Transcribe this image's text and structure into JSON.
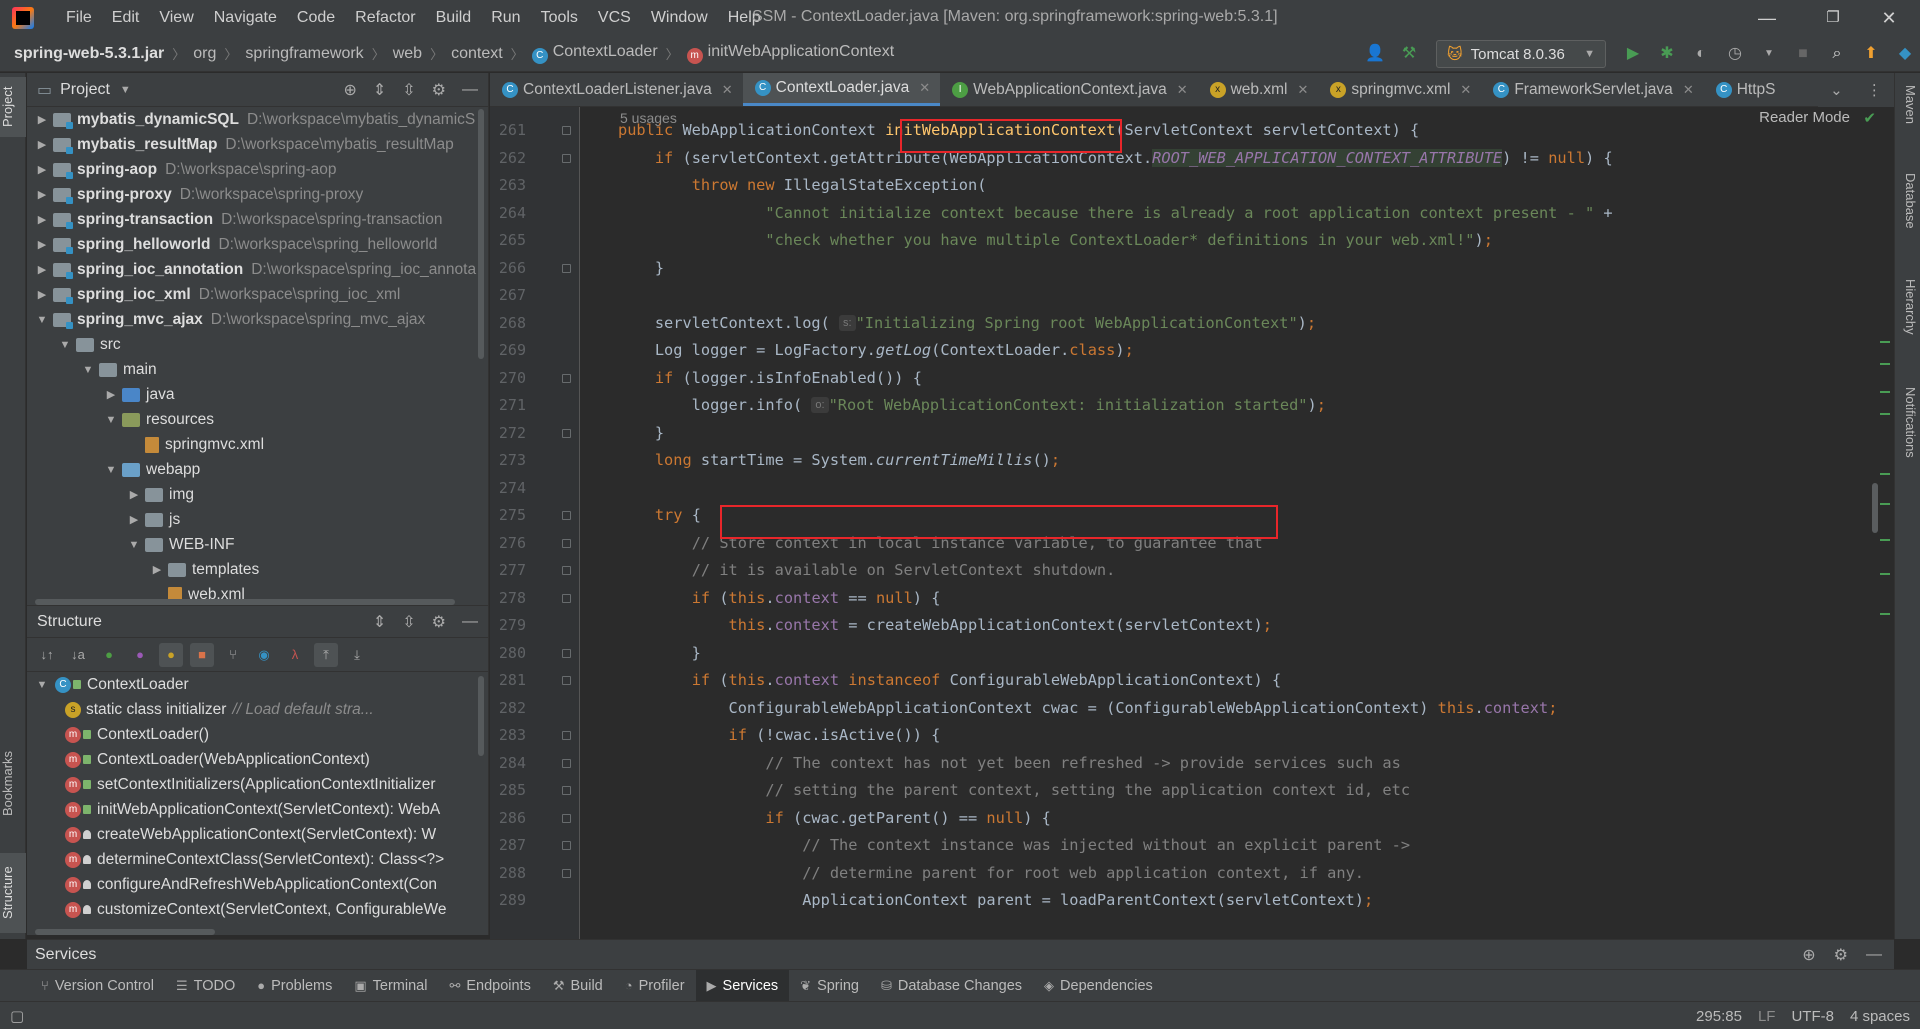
{
  "titlebar": {
    "menu": [
      "File",
      "Edit",
      "View",
      "Navigate",
      "Code",
      "Refactor",
      "Build",
      "Run",
      "Tools",
      "VCS",
      "Window",
      "Help"
    ],
    "window_title": "SSM - ContextLoader.java [Maven: org.springframework:spring-web:5.3.1]",
    "controls": [
      "—",
      "❐",
      "✕"
    ]
  },
  "breadcrumbs": [
    "spring-web-5.3.1.jar",
    "org",
    "springframework",
    "web",
    "context",
    "ContextLoader",
    "initWebApplicationContext"
  ],
  "run_config": "Tomcat 8.0.36",
  "project_panel": {
    "title": "Project",
    "rows": [
      {
        "name": "mybatis_dynamicSQL",
        "path": "D:\\workspace\\mybatis_dynamicS",
        "depth": 0,
        "arrow": "▶",
        "kind": "module"
      },
      {
        "name": "mybatis_resultMap",
        "path": "D:\\workspace\\mybatis_resultMap",
        "depth": 0,
        "arrow": "▶",
        "kind": "module"
      },
      {
        "name": "spring-aop",
        "path": "D:\\workspace\\spring-aop",
        "depth": 0,
        "arrow": "▶",
        "kind": "module"
      },
      {
        "name": "spring-proxy",
        "path": "D:\\workspace\\spring-proxy",
        "depth": 0,
        "arrow": "▶",
        "kind": "module"
      },
      {
        "name": "spring-transaction",
        "path": "D:\\workspace\\spring-transaction",
        "depth": 0,
        "arrow": "▶",
        "kind": "module"
      },
      {
        "name": "spring_helloworld",
        "path": "D:\\workspace\\spring_helloworld",
        "depth": 0,
        "arrow": "▶",
        "kind": "module"
      },
      {
        "name": "spring_ioc_annotation",
        "path": "D:\\workspace\\spring_ioc_annota",
        "depth": 0,
        "arrow": "▶",
        "kind": "module"
      },
      {
        "name": "spring_ioc_xml",
        "path": "D:\\workspace\\spring_ioc_xml",
        "depth": 0,
        "arrow": "▶",
        "kind": "module"
      },
      {
        "name": "spring_mvc_ajax",
        "path": "D:\\workspace\\spring_mvc_ajax",
        "depth": 0,
        "arrow": "▼",
        "kind": "module"
      },
      {
        "name": "src",
        "path": "",
        "depth": 1,
        "arrow": "▼",
        "kind": "folder"
      },
      {
        "name": "main",
        "path": "",
        "depth": 2,
        "arrow": "▼",
        "kind": "folder"
      },
      {
        "name": "java",
        "path": "",
        "depth": 3,
        "arrow": "▶",
        "kind": "src"
      },
      {
        "name": "resources",
        "path": "",
        "depth": 3,
        "arrow": "▼",
        "kind": "res"
      },
      {
        "name": "springmvc.xml",
        "path": "",
        "depth": 4,
        "arrow": "",
        "kind": "file"
      },
      {
        "name": "webapp",
        "path": "",
        "depth": 3,
        "arrow": "▼",
        "kind": "web"
      },
      {
        "name": "img",
        "path": "",
        "depth": 4,
        "arrow": "▶",
        "kind": "folder"
      },
      {
        "name": "js",
        "path": "",
        "depth": 4,
        "arrow": "▶",
        "kind": "folder"
      },
      {
        "name": "WEB-INF",
        "path": "",
        "depth": 4,
        "arrow": "▼",
        "kind": "folder"
      },
      {
        "name": "templates",
        "path": "",
        "depth": 5,
        "arrow": "▶",
        "kind": "folder"
      },
      {
        "name": "web.xml",
        "path": "",
        "depth": 5,
        "arrow": "",
        "kind": "file"
      }
    ]
  },
  "structure_panel": {
    "title": "Structure",
    "rows": [
      {
        "text": "ContextLoader",
        "hint": "",
        "icon": "c",
        "letter": "C",
        "access": "public",
        "depth": 0,
        "arrow": "▼"
      },
      {
        "text": "static class initializer",
        "hint": "// Load default stra...",
        "icon": "f",
        "letter": "s",
        "access": "",
        "depth": 1,
        "arrow": ""
      },
      {
        "text": "ContextLoader()",
        "hint": "",
        "icon": "m",
        "letter": "m",
        "access": "public",
        "depth": 1,
        "arrow": ""
      },
      {
        "text": "ContextLoader(WebApplicationContext)",
        "hint": "",
        "icon": "m",
        "letter": "m",
        "access": "public",
        "depth": 1,
        "arrow": ""
      },
      {
        "text": "setContextInitializers(ApplicationContextInitializer",
        "hint": "",
        "icon": "m",
        "letter": "m",
        "access": "public",
        "depth": 1,
        "arrow": ""
      },
      {
        "text": "initWebApplicationContext(ServletContext): WebA",
        "hint": "",
        "icon": "m",
        "letter": "m",
        "access": "public",
        "depth": 1,
        "arrow": ""
      },
      {
        "text": "createWebApplicationContext(ServletContext): W",
        "hint": "",
        "icon": "m",
        "letter": "m",
        "access": "protected",
        "depth": 1,
        "arrow": ""
      },
      {
        "text": "determineContextClass(ServletContext): Class<?>",
        "hint": "",
        "icon": "m",
        "letter": "m",
        "access": "protected",
        "depth": 1,
        "arrow": ""
      },
      {
        "text": "configureAndRefreshWebApplicationContext(Con",
        "hint": "",
        "icon": "m",
        "letter": "m",
        "access": "protected",
        "depth": 1,
        "arrow": ""
      },
      {
        "text": "customizeContext(ServletContext, ConfigurableWe",
        "hint": "",
        "icon": "m",
        "letter": "m",
        "access": "protected",
        "depth": 1,
        "arrow": ""
      }
    ]
  },
  "editor": {
    "tabs": [
      {
        "label": "ContextLoaderListener.java",
        "icon": "c",
        "letter": "C",
        "active": false
      },
      {
        "label": "ContextLoader.java",
        "icon": "c",
        "letter": "C",
        "active": true
      },
      {
        "label": "WebApplicationContext.java",
        "icon": "i",
        "letter": "I",
        "active": false
      },
      {
        "label": "web.xml",
        "icon": "f",
        "letter": "x",
        "active": false
      },
      {
        "label": "springmvc.xml",
        "icon": "f",
        "letter": "x",
        "active": false
      },
      {
        "label": "FrameworkServlet.java",
        "icon": "c",
        "letter": "C",
        "active": false
      },
      {
        "label": "HttpS",
        "icon": "c",
        "letter": "C",
        "active": false
      }
    ],
    "usages": "5 usages",
    "reader_mode": "Reader Mode",
    "lines": [
      {
        "n": "261",
        "fold": true,
        "html": "<span class=\"kw\">public </span>WebApplicationContext <span class=\"fn\">initWebApplicationContext</span>(ServletContext servletContext) {"
      },
      {
        "n": "262",
        "fold": true,
        "html": "    <span class=\"kw\">if </span>(servletContext.getAttribute(WebApplicationContext.<span class=\"cnst\">ROOT_WEB_APPLICATION_CONTEXT_ATTRIBUTE</span>) != <span class=\"kw\">null</span>) {"
      },
      {
        "n": "263",
        "fold": false,
        "html": "        <span class=\"kw\">throw new </span>IllegalStateException("
      },
      {
        "n": "264",
        "fold": false,
        "html": "                <span class=\"str\">\"Cannot initialize context because there is already a root application context present - \"</span> +"
      },
      {
        "n": "265",
        "fold": false,
        "html": "                <span class=\"str\">\"check whether you have multiple ContextLoader* definitions in your web.xml!\"</span>)<span class=\"kw\">;</span>"
      },
      {
        "n": "266",
        "fold": true,
        "html": "    }"
      },
      {
        "n": "267",
        "fold": false,
        "html": ""
      },
      {
        "n": "268",
        "fold": false,
        "html": "    servletContext.log( <span class=\"hintbox\">s:</span><span class=\"str\">\"Initializing Spring root WebApplicationContext\"</span>)<span class=\"kw\">;</span>"
      },
      {
        "n": "269",
        "fold": false,
        "html": "    Log logger = LogFactory.<span class=\"ital\">getLog</span>(ContextLoader.<span class=\"kw\">class</span>)<span class=\"kw\">;</span>"
      },
      {
        "n": "270",
        "fold": true,
        "html": "    <span class=\"kw\">if </span>(logger.isInfoEnabled()) {"
      },
      {
        "n": "271",
        "fold": false,
        "html": "        logger.info( <span class=\"hintbox\">o:</span><span class=\"str\">\"Root WebApplicationContext: initialization started\"</span>)<span class=\"kw\">;</span>"
      },
      {
        "n": "272",
        "fold": true,
        "html": "    }"
      },
      {
        "n": "273",
        "fold": false,
        "html": "    <span class=\"kw\">long </span>startTime = System.<span class=\"ital\">currentTimeMillis</span>()<span class=\"kw\">;</span>"
      },
      {
        "n": "274",
        "fold": false,
        "html": ""
      },
      {
        "n": "275",
        "fold": true,
        "html": "    <span class=\"kw\">try </span>{"
      },
      {
        "n": "276",
        "fold": true,
        "html": "        <span class=\"cmt\">// Store context in local instance variable, to guarantee that</span>"
      },
      {
        "n": "277",
        "fold": true,
        "html": "        <span class=\"cmt\">// it is available on ServletContext shutdown.</span>"
      },
      {
        "n": "278",
        "fold": true,
        "html": "        <span class=\"kw\">if </span>(<span class=\"kw\">this</span>.<span class=\"fld\">context </span>== <span class=\"kw\">null</span>) {"
      },
      {
        "n": "279",
        "fold": false,
        "html": "            <span class=\"kw\">this</span>.<span class=\"fld\">context </span>= createWebApplicationContext(servletContext)<span class=\"kw\">;</span>"
      },
      {
        "n": "280",
        "fold": true,
        "html": "        }"
      },
      {
        "n": "281",
        "fold": true,
        "html": "        <span class=\"kw\">if </span>(<span class=\"kw\">this</span>.<span class=\"fld\">context </span><span class=\"kw\">instanceof </span>ConfigurableWebApplicationContext) {"
      },
      {
        "n": "282",
        "fold": false,
        "html": "            ConfigurableWebApplicationContext cwac = (ConfigurableWebApplicationContext) <span class=\"kw\">this</span>.<span class=\"fld\">context</span><span class=\"kw\">;</span>"
      },
      {
        "n": "283",
        "fold": true,
        "html": "            <span class=\"kw\">if </span>(!cwac.isActive()) {"
      },
      {
        "n": "284",
        "fold": true,
        "html": "                <span class=\"cmt\">// The context has not yet been refreshed -> provide services such as</span>"
      },
      {
        "n": "285",
        "fold": true,
        "html": "                <span class=\"cmt\">// setting the parent context, setting the application context id, etc</span>"
      },
      {
        "n": "286",
        "fold": true,
        "html": "                <span class=\"kw\">if </span>(cwac.getParent() == <span class=\"kw\">null</span>) {"
      },
      {
        "n": "287",
        "fold": true,
        "html": "                    <span class=\"cmt\">// The context instance was injected without an explicit parent -></span>"
      },
      {
        "n": "288",
        "fold": true,
        "html": "                    <span class=\"cmt\">// determine parent for root web application context, if any.</span>"
      },
      {
        "n": "289",
        "fold": false,
        "html": "                    ApplicationContext parent = loadParentContext(servletContext)<span class=\"kw\">;</span>"
      }
    ]
  },
  "left_strip": {
    "project": "Project",
    "bookmarks": "Bookmarks",
    "structure": "Structure"
  },
  "right_strip": {
    "maven": "Maven",
    "database": "Database",
    "hierarchy": "Hierarchy",
    "notifications": "Notifications"
  },
  "services": {
    "title": "Services"
  },
  "bottom_tabs": [
    {
      "label": "Version Control",
      "icon": "⑂",
      "active": false
    },
    {
      "label": "TODO",
      "icon": "☰",
      "active": false
    },
    {
      "label": "Problems",
      "icon": "●",
      "active": false
    },
    {
      "label": "Terminal",
      "icon": "▣",
      "active": false
    },
    {
      "label": "Endpoints",
      "icon": "⚯",
      "active": false
    },
    {
      "label": "Build",
      "icon": "⚒",
      "active": false
    },
    {
      "label": "Profiler",
      "icon": "◔",
      "active": false
    },
    {
      "label": "Services",
      "icon": "▶",
      "active": true
    },
    {
      "label": "Spring",
      "icon": "❦",
      "active": false
    },
    {
      "label": "Database Changes",
      "icon": "⛁",
      "active": false
    },
    {
      "label": "Dependencies",
      "icon": "◈",
      "active": false
    }
  ],
  "status": {
    "position": "295:85",
    "line_sep": "LF",
    "encoding": "UTF-8",
    "indent": "4 spaces"
  },
  "colors": {
    "highlight_box": "#e8262a",
    "accent": "#4a88c7",
    "background": "#2b2b2b"
  }
}
